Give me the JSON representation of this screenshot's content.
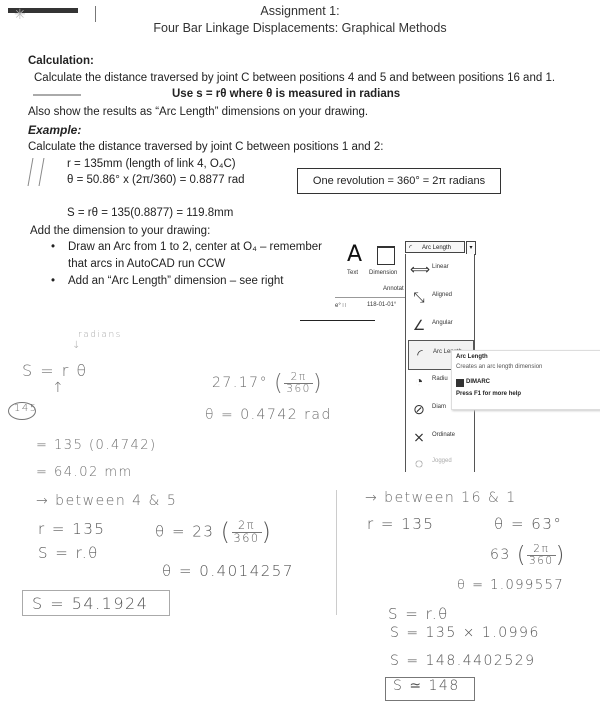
{
  "header": {
    "title_line1": "Assignment 1:",
    "title_line2": "Four Bar Linkage Displacements: Graphical Methods"
  },
  "calculation": {
    "heading": "Calculation:",
    "instruction": "Calculate the distance traversed by joint C between positions 4 and 5 and between positions 16 and 1.",
    "formula_note": "Use s = rθ where θ is measured in radians",
    "also_show": "Also show the results as “Arc Length” dimensions on your drawing."
  },
  "example": {
    "heading": "Example:",
    "task": "Calculate the distance traversed by joint C between positions 1 and 2:",
    "r_line": "r = 135mm (length of link 4, O₄C)",
    "theta_line": "θ = 50.86° x (2π/360) = 0.8877 rad",
    "revolution_box": "One revolution = 360° = 2π radians",
    "s_line": "S = rθ = 135(0.8877) = 119.8mm",
    "add_dimension": "Add the dimension to your drawing:",
    "bullets": [
      {
        "line1": "Draw an Arc from 1 to 2, center at O₄ – remember",
        "line2": "that arcs in AutoCAD run CCW"
      },
      {
        "line1": "Add an “Arc Length” dimension – see right",
        "line2": ""
      }
    ]
  },
  "autocad_panel": {
    "text_tool": "Text",
    "dimension_tool": "Dimension",
    "group_label": "Annotat",
    "coords_prefix": "e°  ∷",
    "coords_value": "118-01-01°",
    "dropdown_selected": "Arc Length",
    "dropdown_arrow": "▾",
    "items": [
      {
        "label": "Linear",
        "icon": "linear-dim-icon",
        "glyph": "⟺",
        "state": "normal"
      },
      {
        "label": "Aligned",
        "icon": "aligned-dim-icon",
        "glyph": "⤡",
        "state": "normal"
      },
      {
        "label": "Angular",
        "icon": "angular-dim-icon",
        "glyph": "∠",
        "state": "normal"
      },
      {
        "label": "Arc Length",
        "icon": "arc-length-icon",
        "glyph": "◜",
        "state": "active"
      },
      {
        "label": "Radiu",
        "icon": "radius-icon",
        "glyph": "◔",
        "state": "normal"
      },
      {
        "label": "Diam",
        "icon": "diameter-icon",
        "glyph": "⊘",
        "state": "normal"
      },
      {
        "label": "Ordinate",
        "icon": "ordinate-icon",
        "glyph": "⨯",
        "state": "normal"
      },
      {
        "label": "Jogged",
        "icon": "jogged-icon",
        "glyph": "◌",
        "state": "disabled"
      }
    ],
    "tooltip": {
      "title": "Arc Length",
      "description": "Creates an arc length dimension",
      "command": "DIMARC",
      "help": "Press F1 for more help"
    }
  },
  "handwritten": {
    "radians_note": "radians",
    "s_eq_r_theta": "S = r θ",
    "circled_value": "145",
    "angle_expr": "27.17°",
    "frac_num": "2π",
    "frac_den": "360",
    "theta_result": "θ = 0.4742 rad",
    "calc1": "= 135 (0.4742)",
    "calc1_result": "= 64.02 mm",
    "section_4_5": {
      "heading": "→ between 4 & 5",
      "r": "r = 135",
      "s_formula": "S = r.θ",
      "theta_expr": "θ = 23",
      "frac_num": "2π",
      "frac_den": "360",
      "theta_value": "θ = 0.4014257",
      "s_result": "S = 54.1924"
    },
    "section_16_1": {
      "heading": "→ between 16 & 1",
      "r": "r = 135",
      "theta_deg": "θ = 63°",
      "theta_expr": "63",
      "frac_num": "2π",
      "frac_den": "360",
      "theta_value": "θ = 1.099557",
      "s_formula": "S = r.θ",
      "s_sub": "S = 135 × 1.0996",
      "s_value": "S = 148.4402529",
      "s_result": "S ≃ 148"
    }
  }
}
